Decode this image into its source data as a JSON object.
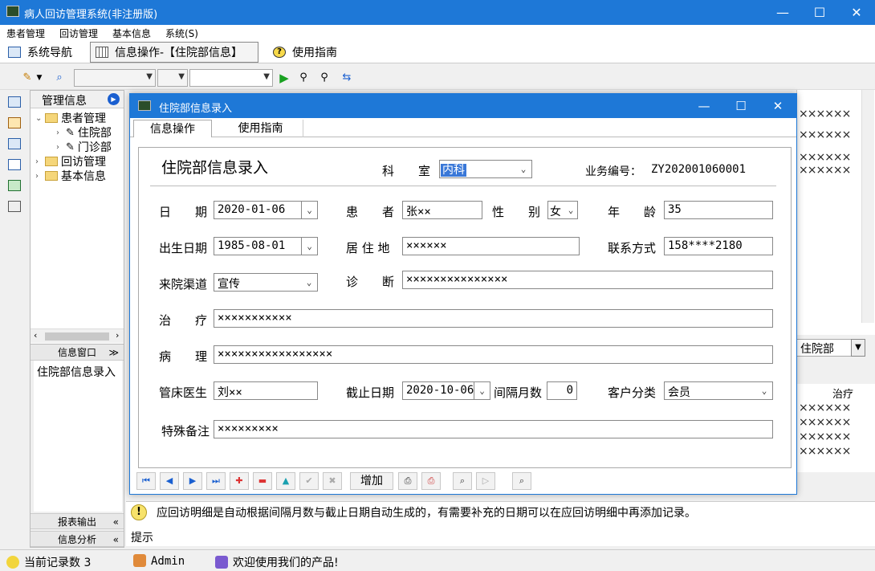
{
  "window": {
    "title": "病人回访管理系统(非注册版)",
    "controls": {
      "minimize": "—",
      "maximize": "☐",
      "close": "✕"
    }
  },
  "menu": [
    "患者管理",
    "回访管理",
    "基本信息",
    "系统(S)"
  ],
  "tabs": [
    {
      "label": "系统导航"
    },
    {
      "label": "信息操作-【住院部信息】"
    },
    {
      "label": "使用指南"
    }
  ],
  "left_panel": {
    "header": "管理信息",
    "tree": {
      "patients": "患者管理",
      "inpatient": "住院部",
      "outpatient": "门诊部",
      "followup": "回访管理",
      "basic": "基本信息"
    },
    "info_window": {
      "header": "信息窗口",
      "items": [
        "住院部信息录入"
      ]
    },
    "report_export": "报表输出",
    "info_analysis": "信息分析"
  },
  "right_behind": {
    "grid_text": "××××××",
    "combo": "住院部",
    "col_header": "治疗"
  },
  "dialog": {
    "title": "住院部信息录入",
    "controls": {
      "minimize": "—",
      "maximize": "☐",
      "close": "✕"
    },
    "tabs": [
      "信息操作",
      "使用指南"
    ],
    "form_title": "住院部信息录入",
    "labels": {
      "dept": "科　　室",
      "biz_no": "业务编号：",
      "date": "日　　期",
      "patient": "患　　者",
      "gender": "性　　别",
      "age": "年　　龄",
      "birth": "出生日期",
      "address": "居 住 地",
      "contact": "联系方式",
      "channel": "来院渠道",
      "diagnosis": "诊　　断",
      "treatment": "治　　疗",
      "pathology": "病　　理",
      "doctor": "管床医生",
      "deadline": "截止日期",
      "interval": "间隔月数",
      "customer": "客户分类",
      "remark": "特殊备注"
    },
    "values": {
      "dept": "内科",
      "biz_no": "ZY202001060001",
      "date": "2020-01-06",
      "patient": "张××",
      "gender": "女",
      "age": "35",
      "birth": "1985-08-01",
      "address": "××××××",
      "contact": "158****2180",
      "channel": "宣传",
      "diagnosis": "×××××××××××××××",
      "treatment": "×××××××××××",
      "pathology": "×××××××××××××××××",
      "doctor": "刘××",
      "deadline": "2020-10-06",
      "interval": "0",
      "customer": "会员",
      "remark": "×××××××××"
    },
    "add_button": "增加"
  },
  "hint": {
    "message": "应回访明细是自动根据间隔月数与截止日期自动生成的，有需要补充的日期可以在应回访明细中再添加记录。",
    "label": "提示"
  },
  "status": {
    "records": "当前记录数 3",
    "user": "Admin",
    "welcome": "欢迎使用我们的产品!"
  },
  "colors": {
    "accent": "#1e78d7",
    "selection": "#3a78d8"
  }
}
